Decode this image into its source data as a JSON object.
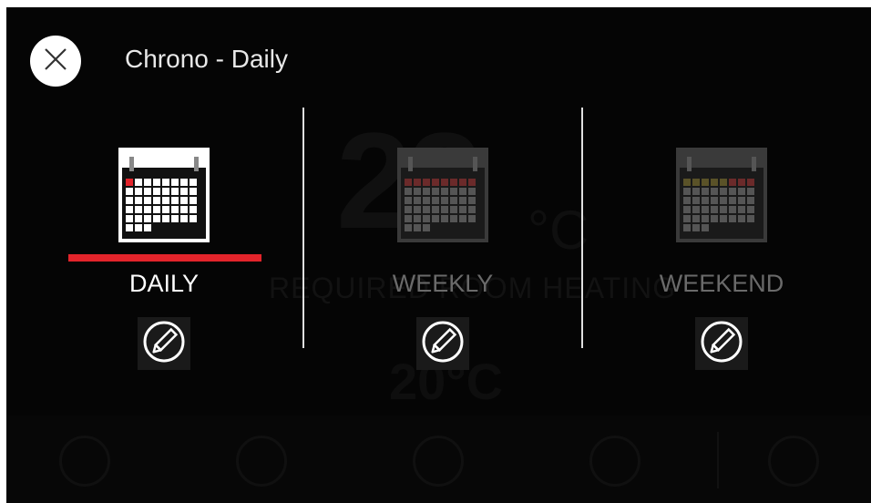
{
  "header": {
    "title": "Chrono - Daily",
    "close_icon": "close-icon"
  },
  "modes": [
    {
      "id": "daily",
      "label": "DAILY",
      "selected": true,
      "icon": "calendar-icon",
      "edit_icon": "pencil-icon"
    },
    {
      "id": "weekly",
      "label": "WEEKLY",
      "selected": false,
      "icon": "calendar-icon",
      "edit_icon": "pencil-icon"
    },
    {
      "id": "weekend",
      "label": "WEEKEND",
      "selected": false,
      "icon": "calendar-icon",
      "edit_icon": "pencil-icon"
    }
  ],
  "colors": {
    "background": "#050505",
    "accent": "#e3242b",
    "text": "#ffffff",
    "inactive_text": "#6a6a6a"
  }
}
